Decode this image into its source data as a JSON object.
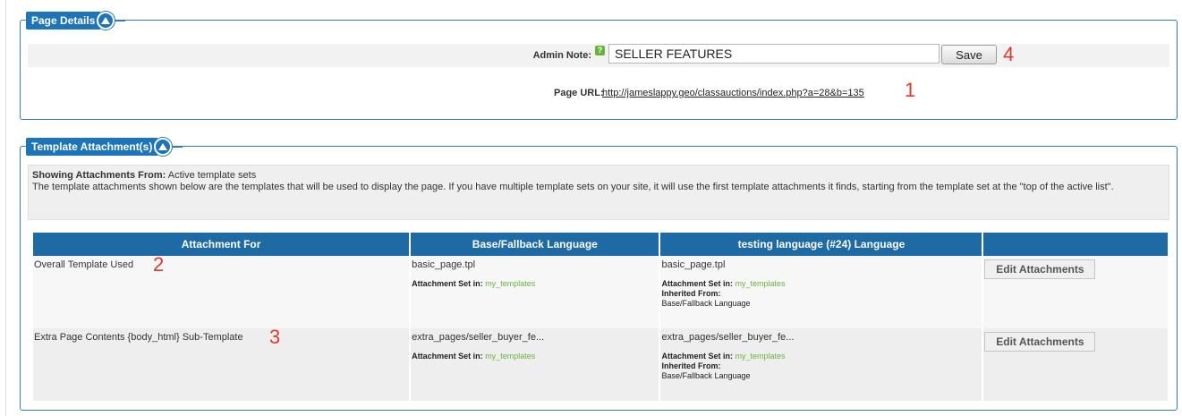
{
  "page_details": {
    "legend": "Page Details",
    "admin_note_label": "Admin Note:",
    "admin_note_value": "SELLER FEATURES",
    "save_label": "Save",
    "page_url_label": "Page URL:",
    "page_url": "http://jameslappy.geo/classauctions/index.php?a=28&b=135"
  },
  "annotations": [
    "1",
    "2",
    "3",
    "4"
  ],
  "template_attachments": {
    "legend": "Template Attachment(s)",
    "showing_label": "Showing Attachments From:",
    "showing_value": "Active template sets",
    "description": "The template attachments shown below are the templates that will be used to display the page.  If you have multiple template sets on your site, it will use the first template attachments it finds, starting from the template set at the \"top of the active list\".",
    "columns": [
      "Attachment For",
      "Base/Fallback Language",
      "testing language (#24) Language",
      ""
    ],
    "rows": [
      {
        "attachment_for": "Overall Template Used",
        "base_template": "basic_page.tpl",
        "base_set_label": "Attachment Set in:",
        "base_set_value": "my_templates",
        "lang_template": "basic_page.tpl",
        "lang_set_label": "Attachment Set in:",
        "lang_set_value": "my_templates",
        "inherited_label": "Inherited From:",
        "inherited_value": "Base/Fallback Language",
        "edit_label": "Edit Attachments"
      },
      {
        "attachment_for": "Extra Page Contents {body_html} Sub-Template",
        "base_template": "extra_pages/seller_buyer_fe...",
        "base_set_label": "Attachment Set in:",
        "base_set_value": "my_templates",
        "lang_template": "extra_pages/seller_buyer_fe...",
        "lang_set_label": "Attachment Set in:",
        "lang_set_value": "my_templates",
        "inherited_label": "Inherited From:",
        "inherited_value": "Base/Fallback Language",
        "edit_label": "Edit Attachments"
      }
    ]
  },
  "colors": {
    "header_blue": "#1e74b8",
    "table_header": "#1e6aa5",
    "accent_green": "#6ab33e",
    "annotation_red": "#e0392b"
  }
}
